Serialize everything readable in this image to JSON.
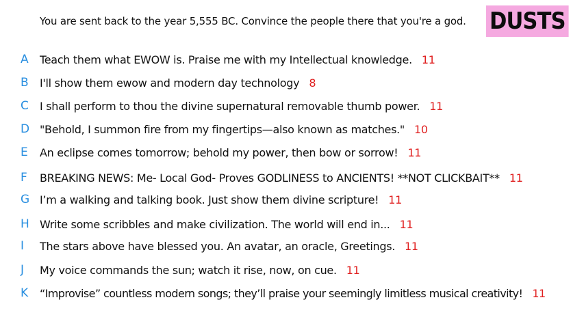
{
  "header": {
    "prompt": "You are sent back to the year 5,555 BC. Convince the people there that you're a god.",
    "logo": "DUSTS"
  },
  "colors": {
    "letter": "#2a8fe0",
    "score": "#e02020",
    "logo_bg": "#f5a9e0"
  },
  "entries": [
    {
      "letter": "A",
      "text": "Teach them what EWOW is. Praise me with my Intellectual knowledge.",
      "score": "11"
    },
    {
      "letter": "B",
      "text": "I'll show them ewow and modern day technology",
      "score": "8"
    },
    {
      "letter": "C",
      "text": "I shall perform to thou the divine supernatural removable thumb power.",
      "score": "11"
    },
    {
      "letter": "D",
      "text": "\"Behold, I summon fire from my fingertips—also known as matches.\"",
      "score": "10"
    },
    {
      "letter": "E",
      "text": "An eclipse comes tomorrow; behold my power, then bow or sorrow!",
      "score": "11"
    },
    {
      "letter": "F",
      "text": "BREAKING NEWS: Me- Local God- Proves GODLINESS to ANCIENTS! **NOT CLICKBAIT**",
      "score": "11"
    },
    {
      "letter": "G",
      "text": "I’m a walking and talking book. Just show them divine scripture!",
      "score": "11"
    },
    {
      "letter": "H",
      "text": "Write some scribbles and make civilization. The world will end in...",
      "score": "11"
    },
    {
      "letter": "I",
      "text": "The stars above have blessed you. An avatar, an oracle, Greetings.",
      "score": "11"
    },
    {
      "letter": "J",
      "text": "My voice commands the sun; watch it rise, now, on cue.",
      "score": "11"
    },
    {
      "letter": "K",
      "text": "“Improvise” countless modern songs; they’ll praise your seemingly limitless musical creativity!",
      "score": "11"
    }
  ]
}
